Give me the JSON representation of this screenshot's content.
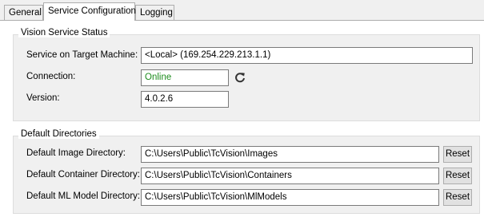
{
  "tabs": [
    {
      "label": "General",
      "active": false
    },
    {
      "label": "Service Configuration",
      "active": true
    },
    {
      "label": "Logging",
      "active": false
    }
  ],
  "status_group": {
    "title": "Vision Service Status",
    "service_label": "Service on Target Machine:",
    "service_value": "<Local> (169.254.229.213.1.1)",
    "connection_label": "Connection:",
    "connection_value": "Online",
    "connection_color": "#1e8c1e",
    "refresh_icon": "refresh-icon",
    "version_label": "Version:",
    "version_value": "4.0.2.6"
  },
  "directories_group": {
    "title": "Default Directories",
    "rows": [
      {
        "label": "Default Image Directory:",
        "value": "C:\\Users\\Public\\TcVision\\Images",
        "button": "Reset"
      },
      {
        "label": "Default Container Directory:",
        "value": "C:\\Users\\Public\\TcVision\\Containers",
        "button": "Reset"
      },
      {
        "label": "Default ML Model Directory:",
        "value": "C:\\Users\\Public\\TcVision\\MlModels",
        "button": "Reset"
      }
    ]
  }
}
